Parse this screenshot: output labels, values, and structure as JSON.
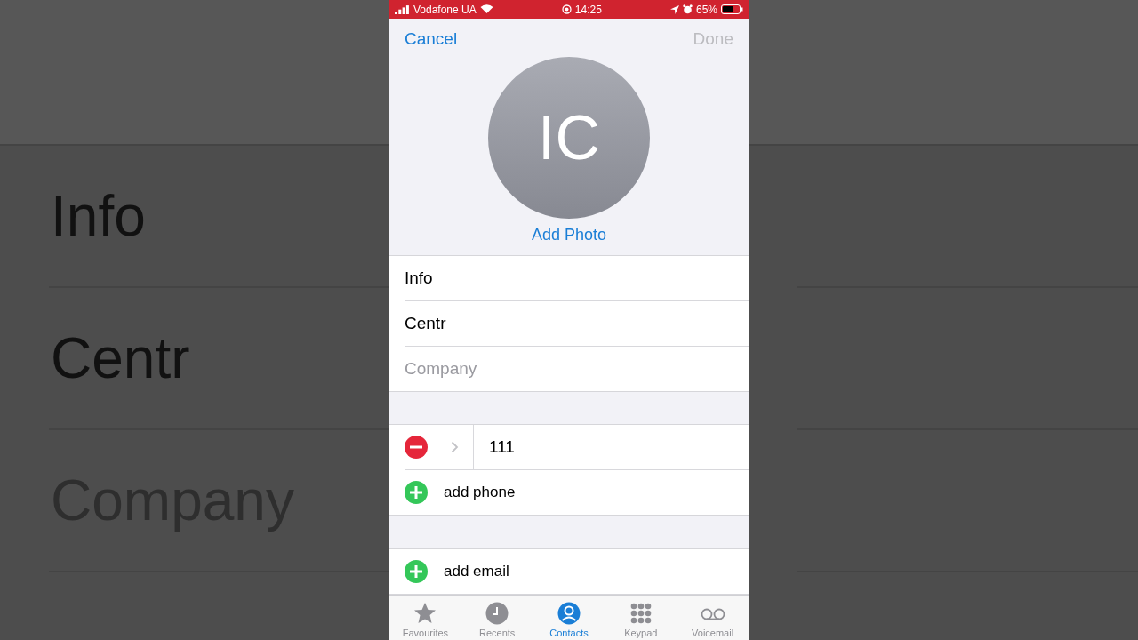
{
  "backdrop": {
    "labels": [
      {
        "text": "Info",
        "placeholder": false
      },
      {
        "text": "Centr",
        "placeholder": false
      },
      {
        "text": "Company",
        "placeholder": true
      }
    ]
  },
  "status_bar": {
    "carrier": "Vodafone UA",
    "time": "14:25",
    "battery": "65%"
  },
  "nav": {
    "cancel": "Cancel",
    "done": {
      "label": "Done",
      "disabled": true
    }
  },
  "avatar": {
    "initials": "IC",
    "action": "Add Photo"
  },
  "name_fields": [
    {
      "value": "Info"
    },
    {
      "value": "Centr"
    },
    {
      "placeholder": "Company"
    }
  ],
  "phones": [
    {
      "value": "111"
    }
  ],
  "add_phone": "add phone",
  "add_email": "add email",
  "tabs": [
    {
      "label": "Favourites",
      "kind": "star",
      "selected": false
    },
    {
      "label": "Recents",
      "kind": "clock",
      "selected": false
    },
    {
      "label": "Contacts",
      "kind": "person",
      "selected": true
    },
    {
      "label": "Keypad",
      "kind": "keypad",
      "selected": false
    },
    {
      "label": "Voicemail",
      "kind": "voicemail",
      "selected": false
    }
  ]
}
